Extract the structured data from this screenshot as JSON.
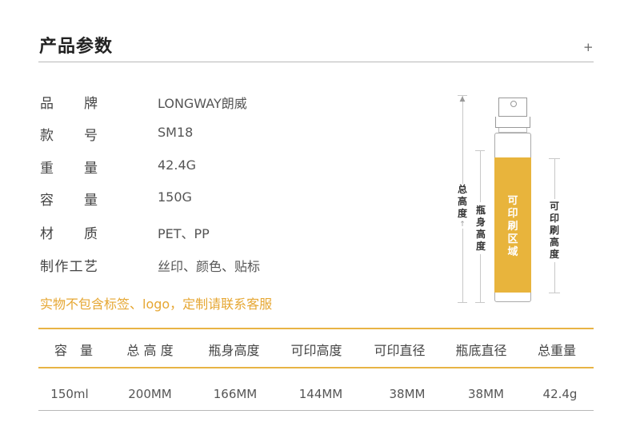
{
  "header": {
    "title": "产品参数",
    "expand_symbol": "+"
  },
  "specs": [
    {
      "label": "品牌",
      "value": "LONGWAY朗威"
    },
    {
      "label": "款号",
      "value": "SM18"
    },
    {
      "label": "重量",
      "value": "42.4G"
    },
    {
      "label": "容量",
      "value": "150G"
    },
    {
      "label": "材质",
      "value": "PET、PP"
    },
    {
      "label": "制作工艺",
      "value": "丝印、颜色、贴标"
    }
  ],
  "note": "实物不包含标签、logo，定制请联系客服",
  "diagram": {
    "total_height_label": "总高度",
    "body_height_label": "瓶身高度",
    "print_area_label": "可印刷区域",
    "print_height_label": "可印刷高度",
    "print_area_color": "#e8b43c"
  },
  "table": {
    "headers": [
      "容　量",
      "总 高 度",
      "瓶身高度",
      "可印高度",
      "可印直径",
      "瓶底直径",
      "总重量"
    ],
    "row": [
      "150ml",
      "200MM",
      "166MM",
      "144MM",
      "38MM",
      "38MM",
      "42.4g"
    ]
  }
}
